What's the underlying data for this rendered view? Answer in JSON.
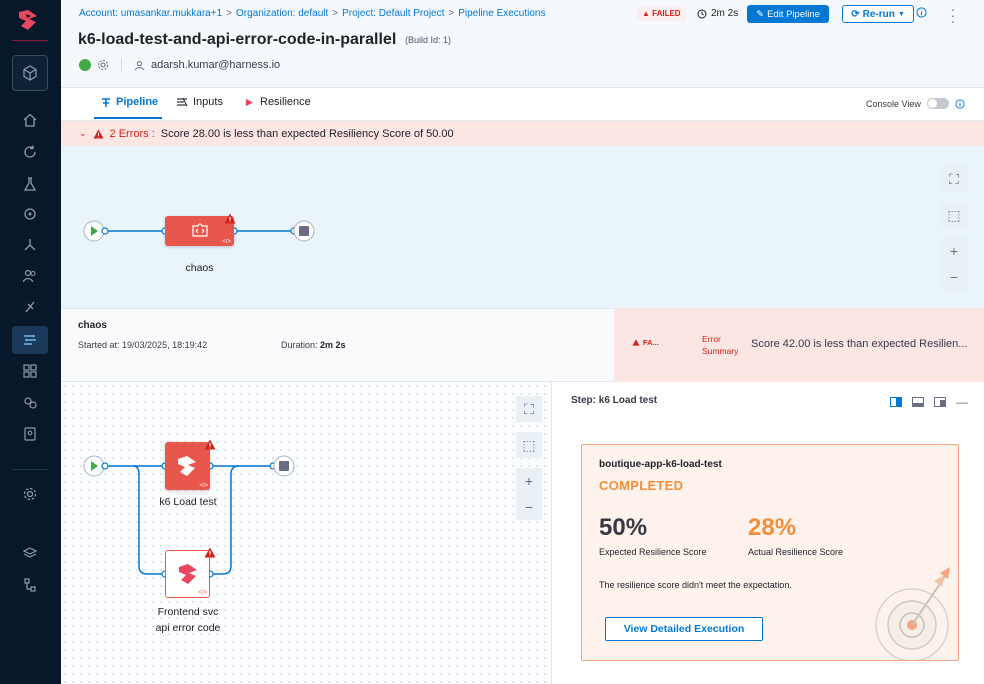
{
  "breadcrumbs": {
    "account": "Account: umasankar.mukkara+1",
    "organization": "Organization: default",
    "project": "Project: Default Project",
    "section": "Pipeline Executions"
  },
  "header": {
    "title": "k6-load-test-and-api-error-code-in-parallel",
    "build_id": "(Build Id: 1)",
    "user": "adarsh.kumar@harness.io",
    "status_badge": "FAILED",
    "duration": "2m 2s",
    "edit_label": "Edit Pipeline",
    "rerun_label": "Re-run"
  },
  "tabs": {
    "pipeline": "Pipeline",
    "inputs": "Inputs",
    "resilience": "Resilience",
    "console_view": "Console View"
  },
  "error_banner": {
    "count_label": "2 Errors :",
    "message": "Score 28.00 is less than expected Resiliency Score of 50.00"
  },
  "top_pipeline": {
    "stage_name": "chaos"
  },
  "stage_info": {
    "name": "chaos",
    "started_at": "Started at: 19/03/2025, 18:19:42",
    "duration_label": "Duration:",
    "duration_value": "2m 2s",
    "failed_short": "FA...",
    "error_summary_label_1": "Error",
    "error_summary_label_2": "Summary",
    "error_summary_message": "Score 42.00 is less than expected Resilien..."
  },
  "bottom_pipeline": {
    "node1": "k6 Load test",
    "node2_line1": "Frontend svc",
    "node2_line2": "api error code"
  },
  "step_panel": {
    "title": "Step: k6 Load test",
    "card": {
      "name": "boutique-app-k6-load-test",
      "status": "COMPLETED",
      "expected_value": "50%",
      "expected_label": "Expected Resilience Score",
      "actual_value": "28%",
      "actual_label": "Actual Resilience Score",
      "note": "The resilience score didn't meet the expectation.",
      "button": "View Detailed Execution"
    }
  },
  "colors": {
    "accent": "#0278d5",
    "error": "#cf2318",
    "stage_red": "#e8574c",
    "orange": "#f38e3d",
    "nav_bg": "#07182b"
  }
}
